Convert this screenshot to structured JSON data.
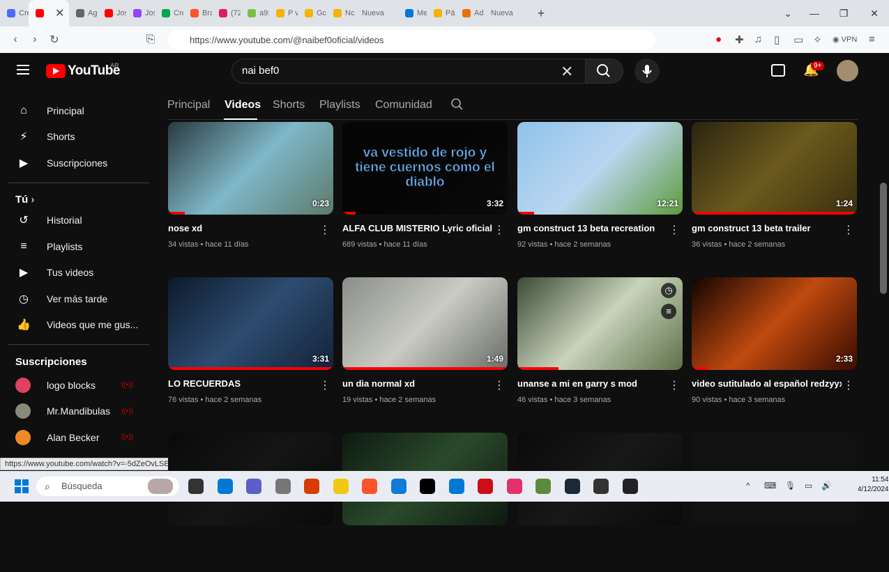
{
  "browser": {
    "tabs": [
      {
        "label": "Cre",
        "color": "#4a6cf7"
      },
      {
        "label": "",
        "color": "#ff0000",
        "active": true
      },
      {
        "label": "Ag",
        "color": "#666666"
      },
      {
        "label": "Jos",
        "color": "#ff0000"
      },
      {
        "label": "Jos",
        "color": "#9146ff"
      },
      {
        "label": "Cre",
        "color": "#00a650"
      },
      {
        "label": "Bra",
        "color": "#fb542b"
      },
      {
        "label": "(72",
        "color": "#e01e5a"
      },
      {
        "label": "a9:",
        "color": "#7ac143"
      },
      {
        "label": "P v",
        "color": "#f4b400"
      },
      {
        "label": "Gc",
        "color": "#f4b400"
      },
      {
        "label": "Nc",
        "color": "#f4b400"
      },
      {
        "label": "Nueva",
        "color": ""
      },
      {
        "label": "Me",
        "color": "#0078d4"
      },
      {
        "label": "Pác",
        "color": "#f4b400"
      },
      {
        "label": "Ad",
        "color": "#e8710a"
      },
      {
        "label": "Nueva",
        "color": ""
      }
    ],
    "url": "https://www.youtube.com/@naibef0oficial/videos",
    "status_url": "https://www.youtube.com/watch?v=-5dZeOvLSE4&t=161s",
    "vpn_label": "VPN"
  },
  "header": {
    "logo_text": "YouTube",
    "country": "AR",
    "search_value": "nai bef0",
    "notif_badge": "9+"
  },
  "sidebar": {
    "main": [
      {
        "label": "Principal",
        "icon": "home-icon",
        "glyph": "⌂"
      },
      {
        "label": "Shorts",
        "icon": "shorts-icon",
        "glyph": "⚡"
      },
      {
        "label": "Suscripciones",
        "icon": "subscriptions-icon",
        "glyph": "▶"
      }
    ],
    "you_label": "Tú",
    "you": [
      {
        "label": "Historial",
        "icon": "history-icon",
        "glyph": "↺"
      },
      {
        "label": "Playlists",
        "icon": "playlists-icon",
        "glyph": "≡"
      },
      {
        "label": "Tus videos",
        "icon": "your-videos-icon",
        "glyph": "▶"
      },
      {
        "label": "Ver más tarde",
        "icon": "watch-later-icon",
        "glyph": "◷"
      },
      {
        "label": "Videos que me gus...",
        "icon": "liked-icon",
        "glyph": "👍"
      }
    ],
    "subs_heading": "Suscripciones",
    "subs": [
      {
        "label": "logo blocks",
        "color": "#e0415f"
      },
      {
        "label": "Mr.Mandibulas",
        "color": "#8a8a7a"
      },
      {
        "label": "Alan Becker",
        "color": "#f08a24"
      }
    ]
  },
  "channel_tabs": [
    {
      "label": "Principal",
      "active": false
    },
    {
      "label": "Videos",
      "active": true
    },
    {
      "label": "Shorts",
      "active": false
    },
    {
      "label": "Playlists",
      "active": false
    },
    {
      "label": "Comunidad",
      "active": false
    }
  ],
  "videos": [
    {
      "title": "nose xd",
      "meta": "34 vistas • hace 11 días",
      "duration": "0:23",
      "progress": 0.1,
      "colors": [
        "#2b3a3f",
        "#7fb8c9",
        "#5c7a6b"
      ]
    },
    {
      "title": "ALFA CLUB MISTERIO Lyric oficial",
      "meta": "689 vistas • hace 11 días",
      "duration": "3:32",
      "progress": 0.08,
      "colors": [
        "#050505",
        "#050505",
        "#0a0a0a"
      ],
      "overlay_text": "va vestido de rojo y tiene cuernos como el diablo"
    },
    {
      "title": "gm construct 13 beta recreation",
      "meta": "92 vistas • hace 2 semanas",
      "duration": "12:21",
      "progress": 0.1,
      "colors": [
        "#8fc3ea",
        "#b9d6f0",
        "#5e9b3c"
      ]
    },
    {
      "title": "gm construct 13 beta trailer",
      "meta": "36 vistas • hace 2 semanas",
      "duration": "1:24",
      "progress": 1.0,
      "colors": [
        "#2a2410",
        "#6b5a1c",
        "#3a2f10"
      ]
    },
    {
      "title": "LO RECUERDAS",
      "meta": "76 vistas • hace 2 semanas",
      "duration": "3:31",
      "progress": 1.0,
      "colors": [
        "#0c1a2a",
        "#2e4c70",
        "#12233a"
      ]
    },
    {
      "title": "un dia normal xd",
      "meta": "19 vistas • hace 2 semanas",
      "duration": "1:49",
      "progress": 1.0,
      "colors": [
        "#8a8e88",
        "#c9cbc4",
        "#6a6d67"
      ]
    },
    {
      "title": "unanse a mi en garry s mod",
      "meta": "46 vistas • hace 3 semanas",
      "duration": "",
      "progress": 0.25,
      "colors": [
        "#3d4a34",
        "#c7d3bb",
        "#5f7048"
      ]
    },
    {
      "title": "video sutitulado al español redzyyx",
      "meta": "90 vistas • hace 3 semanas",
      "duration": "2:33",
      "progress": 0.1,
      "colors": [
        "#120400",
        "#c04a10",
        "#3a0c00"
      ]
    },
    {
      "title": "",
      "meta": "",
      "duration": "",
      "progress": 0,
      "colors": [
        "#0a0a0a",
        "#151515",
        "#0a0a0a"
      ]
    },
    {
      "title": "",
      "meta": "",
      "duration": "",
      "progress": 0,
      "colors": [
        "#0e1a10",
        "#2a4a2c",
        "#0e1a10"
      ]
    },
    {
      "title": "",
      "meta": "",
      "duration": "",
      "progress": 0,
      "colors": [
        "#0a0a0a",
        "#181818",
        "#0a0a0a"
      ]
    },
    {
      "title": "",
      "meta": "",
      "duration": "",
      "progress": 0,
      "colors": [
        "#111111",
        "#111111",
        "#111111"
      ]
    }
  ],
  "taskbar": {
    "search_placeholder": "Búsqueda",
    "time": "11:54",
    "date": "4/12/2024",
    "apps": [
      "#333333",
      "#0078d4",
      "#5b5fc7",
      "#777777",
      "#d83b01",
      "#f2c811",
      "#fb542b",
      "#0f7bd8",
      "#000000",
      "#0078d4",
      "#cc0f16",
      "#e1306c",
      "#5d8a3a",
      "#1b2838",
      "#333333",
      "#222222"
    ]
  }
}
